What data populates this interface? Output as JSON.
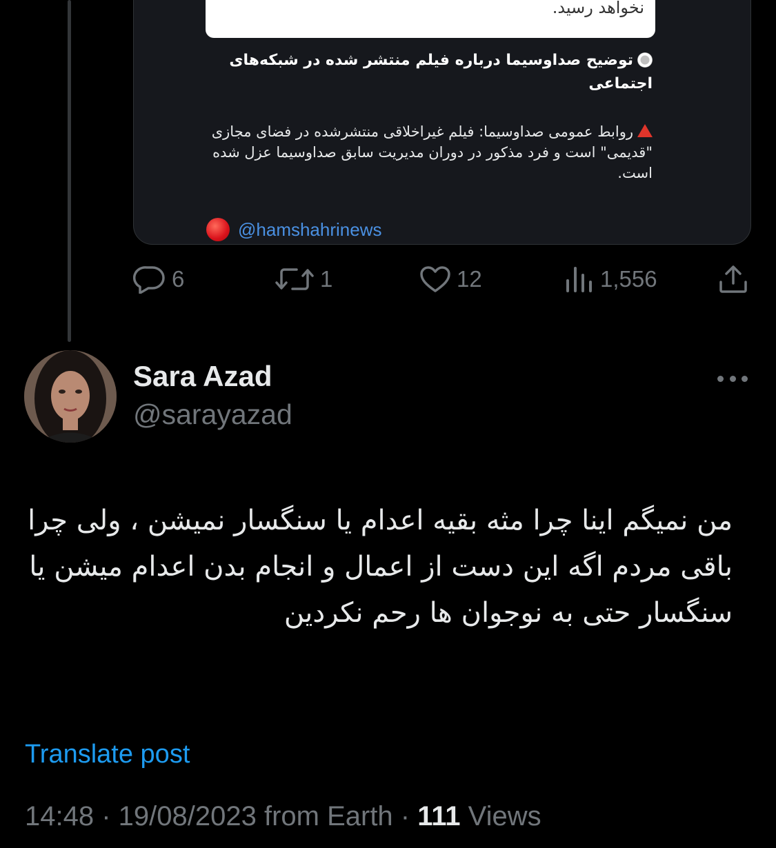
{
  "quoted_post": {
    "top_image_text": "نخواهد رسید.",
    "headline": "توضیح صداوسیما درباره فیلم منتشر شده در شبکه‌های اجتماعی",
    "body": "روابط عمومی صداوسیما: فیلم غیراخلاقی منتشرشده در فضای مجازی \"قدیمی\" است و فرد مذکور در دوران مدیریت سابق صداوسیما عزل شده است.",
    "source_handle": "@hamshahrinews"
  },
  "actions": {
    "replies": "6",
    "reposts": "1",
    "likes": "12",
    "views": "1,556"
  },
  "author": {
    "name": "Sara Azad",
    "handle": "@sarayazad"
  },
  "tweet": {
    "text": "من نمیگم اینا چرا مثه بقیه اعدام یا سنگسار نمیشن ، ولی چرا باقی مردم اگه این دست از اعمال  و انجام بدن اعدام میشن یا سنگسار حتی به نوجوان ها رحم نکردین",
    "translate_label": "Translate post"
  },
  "meta": {
    "timestamp": "14:48 · 19/08/2023 from Earth · ",
    "views_count": "111",
    "views_label": " Views"
  },
  "colors": {
    "accent": "#1d9bf0",
    "muted": "#71767b",
    "background": "#000000"
  },
  "icons": [
    "reply-icon",
    "repost-icon",
    "like-icon",
    "views-icon",
    "share-icon",
    "more-icon"
  ]
}
